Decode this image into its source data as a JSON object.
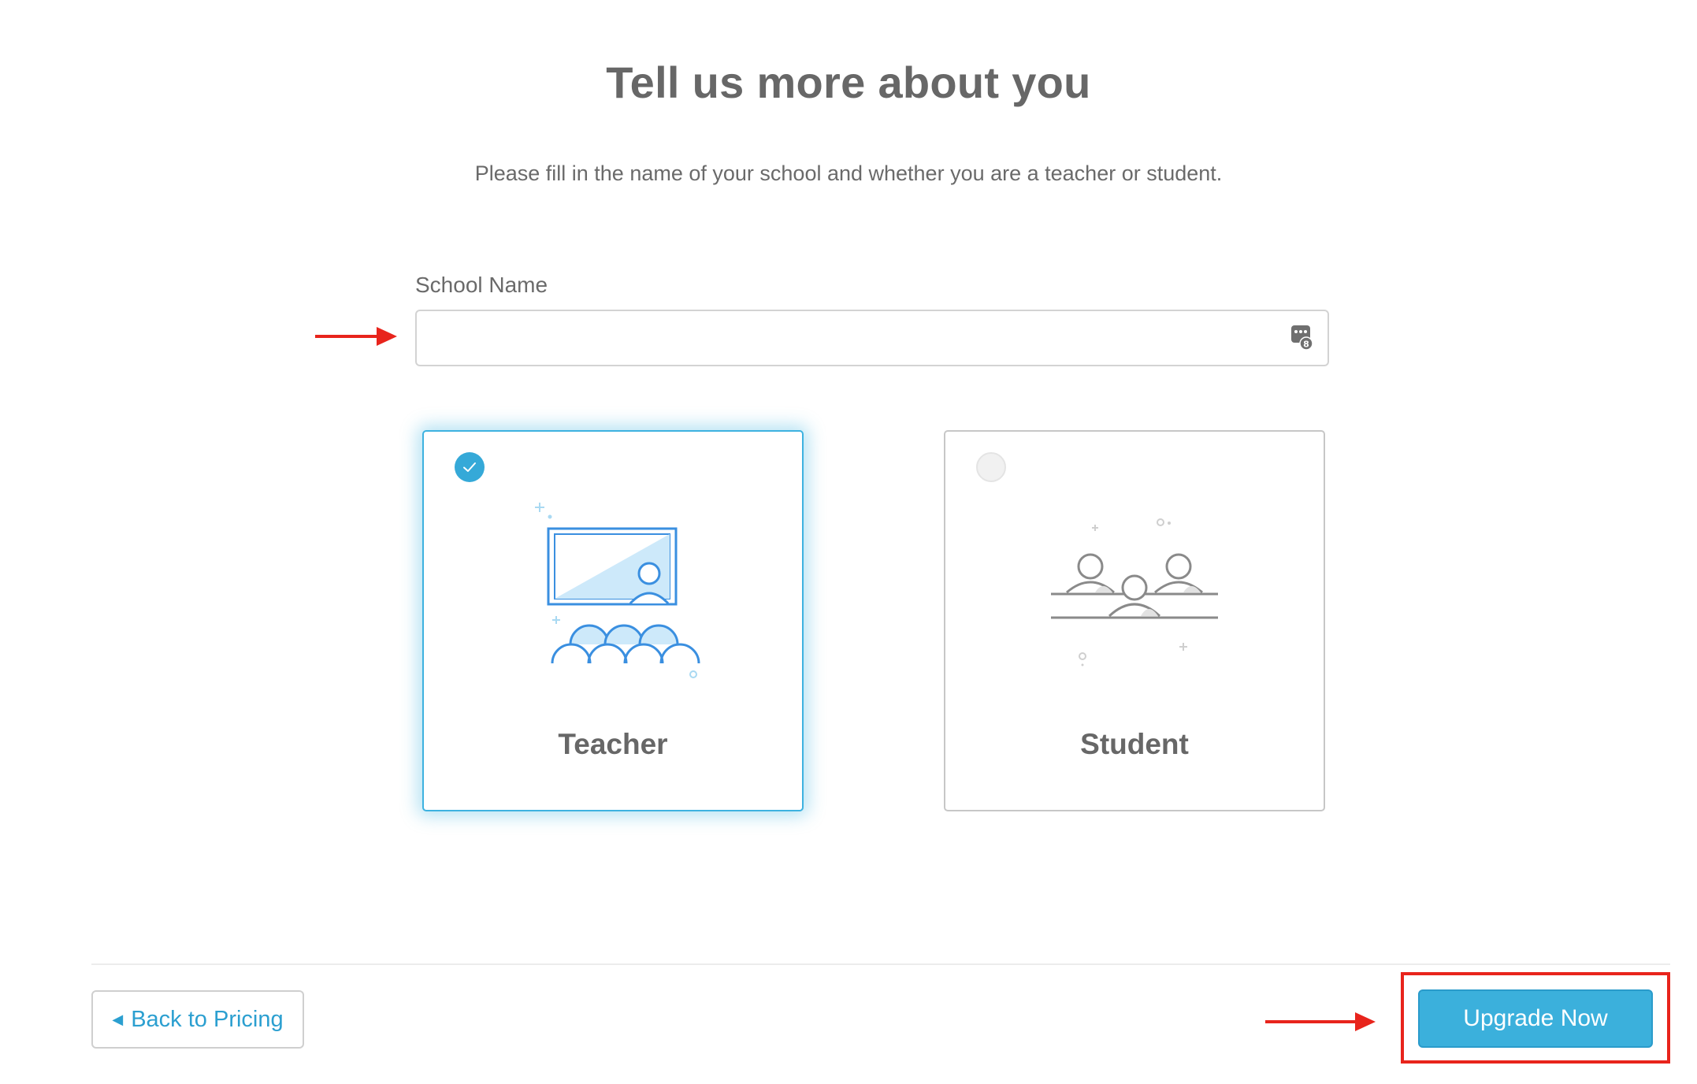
{
  "header": {
    "title": "Tell us more about you",
    "subtitle": "Please fill in the name of your school and whether you are a teacher or student."
  },
  "form": {
    "school_name_label": "School Name",
    "school_name_value": "",
    "school_name_placeholder": "",
    "autofill_icon": "contact-card-icon"
  },
  "roles": [
    {
      "label": "Teacher",
      "selected": true,
      "icon": "classroom-teacher-icon"
    },
    {
      "label": "Student",
      "selected": false,
      "icon": "students-at-desk-icon"
    }
  ],
  "footer": {
    "back_label": "Back to Pricing",
    "back_icon": "caret-left-icon",
    "upgrade_label": "Upgrade Now"
  },
  "annotations": {
    "arrow_color": "#e8241c",
    "highlight_color": "#e8241c"
  },
  "colors": {
    "accent": "#3bb0dc",
    "title": "#676767",
    "link": "#2b9fd0"
  }
}
